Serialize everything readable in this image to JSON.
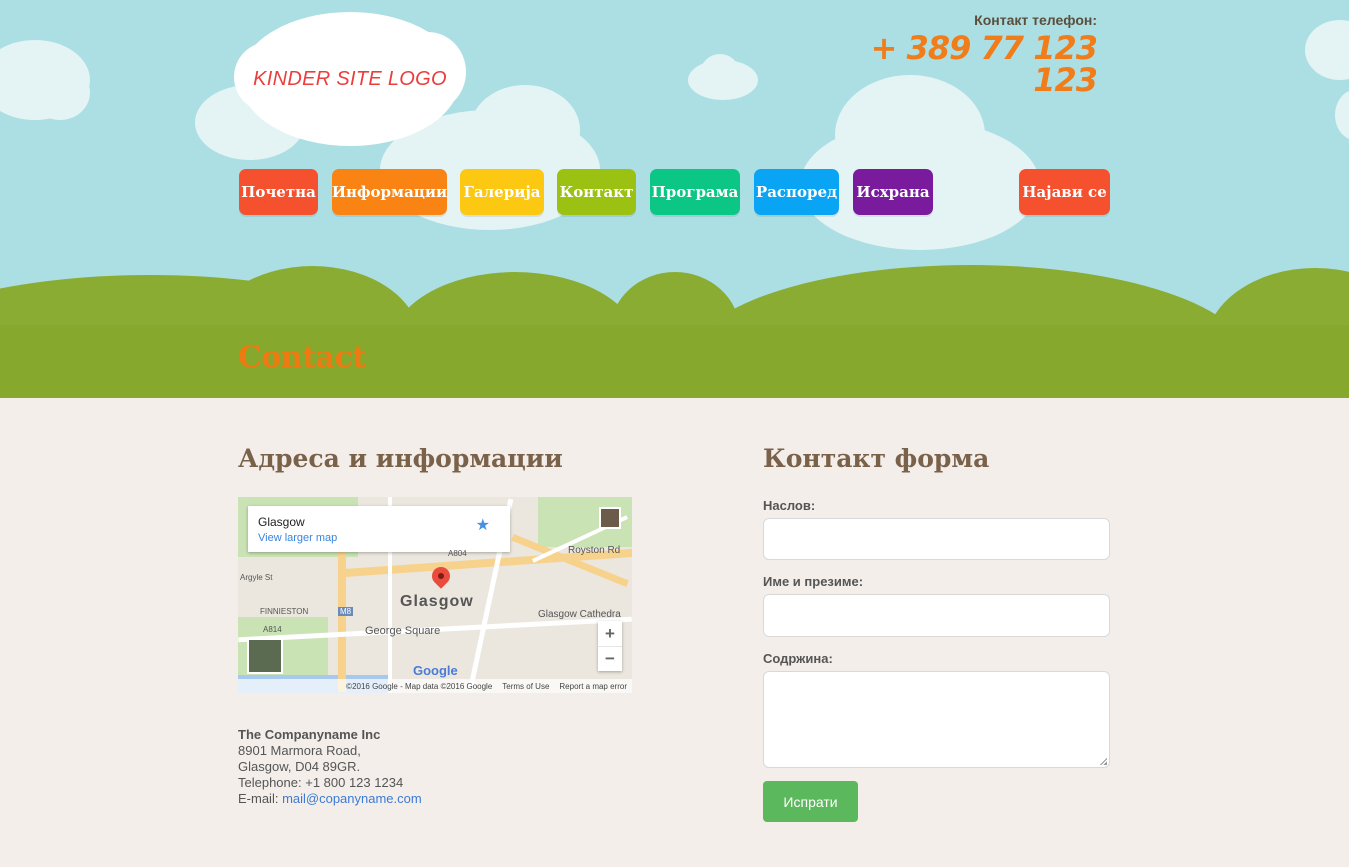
{
  "header": {
    "logo_text": "KINDER SITE LOGO",
    "phone_label": "Контакт телефон:",
    "phone_number": "+ 389 77 123 123"
  },
  "nav": {
    "items": [
      {
        "label": "Почетна",
        "color": "#f5512f"
      },
      {
        "label": "Информации",
        "color": "#fa8413"
      },
      {
        "label": "Галерија",
        "color": "#fcc812"
      },
      {
        "label": "Контакт",
        "color": "#9bc213"
      },
      {
        "label": "Програма",
        "color": "#0bc684"
      },
      {
        "label": "Распоред",
        "color": "#0aa4f5"
      },
      {
        "label": "Исхрана",
        "color": "#7a1b9e"
      }
    ],
    "login": {
      "label": "Најави се",
      "color": "#f5512f"
    }
  },
  "page_title": "Contact",
  "address_section": {
    "title": "Адреса и информации",
    "map": {
      "place": "Glasgow",
      "view_larger": "View larger map",
      "city_label": "Glasgow",
      "labels": [
        "Royston Rd",
        "Glasgow Cathedra",
        "George Square",
        "FINNIESTON",
        "M8",
        "A814",
        "A804",
        "Argyle St"
      ],
      "zoom_in": "+",
      "zoom_out": "−",
      "google": "Google",
      "footer": [
        "©2016 Google - Map data ©2016 Google",
        "Terms of Use",
        "Report a map error"
      ]
    },
    "company": "The Companyname Inc",
    "street": "8901 Marmora Road,",
    "city": "Glasgow, D04 89GR.",
    "telephone": "Telephone: +1 800 123 1234",
    "email_label": "E-mail: ",
    "email": "mail@copanyname.com"
  },
  "contact_form": {
    "title": "Контакт форма",
    "subject_label": "Наслов:",
    "name_label": "Име и презиме:",
    "content_label": "Содржина:",
    "submit_label": "Испрати"
  },
  "colors": {
    "sky": "#acdfe4",
    "grass": "#86a82d",
    "accent_orange": "#ef7a12",
    "submit_green": "#5cb85c"
  }
}
